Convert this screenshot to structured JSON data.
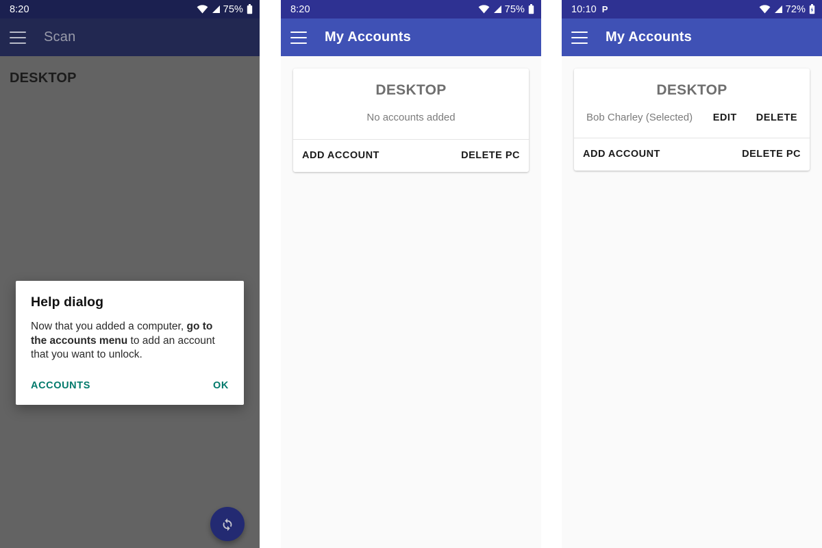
{
  "colors": {
    "status_bar_dimmed": "#1b2050",
    "app_bar_dimmed": "#222851",
    "status_bar": "#2e3192",
    "app_bar": "#3f51b5",
    "scrim_background": "#636363",
    "screen_background": "#fafafa",
    "card_background": "#ffffff",
    "dialog_accent": "#00796b",
    "fab_background": "#232a72",
    "muted_text": "#7b7b7b"
  },
  "panels": [
    {
      "id": "scan-screen",
      "status_bar": {
        "clock": "8:20",
        "badge": "",
        "wifi_icon": "wifi-icon",
        "signal_icon": "cellular-signal-icon",
        "battery_percent": "75%",
        "battery_icon": "battery-icon"
      },
      "app_bar": {
        "menu_icon": "hamburger-menu-icon",
        "title": "Scan"
      },
      "section_header": "DESKTOP",
      "fab": {
        "icon": "refresh-sync-icon"
      },
      "dialog": {
        "title": "Help dialog",
        "body_part_1": "Now that you added a computer, ",
        "body_bold": "go to the accounts menu",
        "body_part_2": " to add an account that you want to unlock.",
        "action_secondary": "ACCOUNTS",
        "action_primary": "OK"
      }
    },
    {
      "id": "my-accounts-empty",
      "status_bar": {
        "clock": "8:20",
        "badge": "",
        "wifi_icon": "wifi-icon",
        "signal_icon": "cellular-signal-icon",
        "battery_percent": "75%",
        "battery_icon": "battery-icon"
      },
      "app_bar": {
        "menu_icon": "hamburger-menu-icon",
        "title": "My Accounts"
      },
      "card": {
        "title": "DESKTOP",
        "empty_message": "No accounts added",
        "accounts": [],
        "action_left": "ADD ACCOUNT",
        "action_right": "DELETE PC"
      }
    },
    {
      "id": "my-accounts-with-account",
      "status_bar": {
        "clock": "10:10",
        "badge": "P",
        "wifi_icon": "wifi-icon",
        "signal_icon": "cellular-signal-icon",
        "battery_percent": "72%",
        "battery_icon": "battery-charging-icon"
      },
      "app_bar": {
        "menu_icon": "hamburger-menu-icon",
        "title": "My Accounts"
      },
      "card": {
        "title": "DESKTOP",
        "empty_message": "",
        "accounts": [
          {
            "name": "Bob Charley (Selected)",
            "edit_label": "EDIT",
            "delete_label": "DELETE"
          }
        ],
        "action_left": "ADD ACCOUNT",
        "action_right": "DELETE PC"
      }
    }
  ]
}
